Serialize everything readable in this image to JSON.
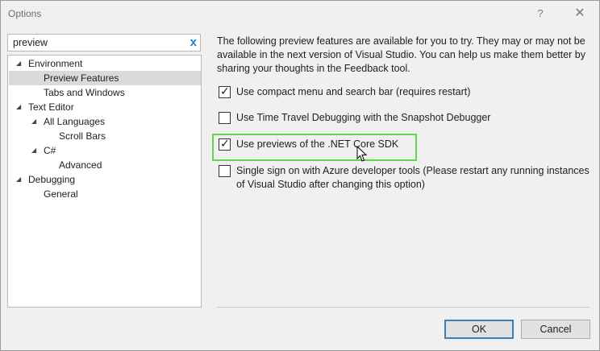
{
  "window": {
    "title": "Options",
    "help_label": "?",
    "close_label": "✕"
  },
  "search": {
    "value": "preview",
    "clear_glyph": "x"
  },
  "tree": {
    "environment": "Environment",
    "preview_features": "Preview Features",
    "tabs_windows": "Tabs and Windows",
    "text_editor": "Text Editor",
    "all_languages": "All Languages",
    "scroll_bars": "Scroll Bars",
    "csharp": "C#",
    "advanced": "Advanced",
    "debugging": "Debugging",
    "general": "General"
  },
  "panel": {
    "description": "The following preview features are available for you to try. They may or may not be available in the next version of Visual Studio. You can help us make them better by sharing your thoughts in the Feedback tool.",
    "options": [
      {
        "label": "Use compact menu and search bar (requires restart)",
        "checked": true
      },
      {
        "label": "Use Time Travel Debugging with the Snapshot Debugger",
        "checked": false
      },
      {
        "label": "Use previews of the .NET Core SDK",
        "checked": true
      },
      {
        "label": "Single sign on with Azure developer tools (Please restart any running instances of Visual Studio after changing this option)",
        "checked": false
      }
    ]
  },
  "buttons": {
    "ok": "OK",
    "cancel": "Cancel"
  },
  "colors": {
    "highlight": "#5fd84a",
    "accent": "#3c7fb1"
  }
}
